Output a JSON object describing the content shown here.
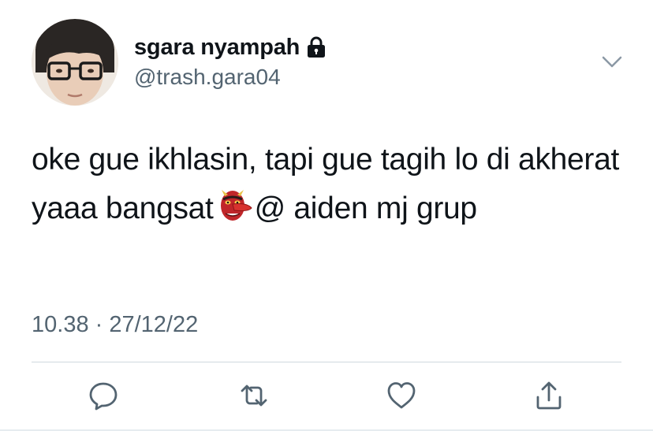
{
  "user": {
    "display_name": "sgara nyampah",
    "handle": "@trash.gara04",
    "protected_icon": "lock-icon",
    "avatar": "profile-photo"
  },
  "tweet": {
    "text_part1": "oke gue ikhlasin, tapi gue tagih lo di akherat yaaa bangsat",
    "emoji": "goblin-mask-emoji",
    "text_part2": "@ aiden mj grup",
    "timestamp": "10.38 · 27/12/22"
  },
  "menu": {
    "icon": "chevron-down-icon"
  },
  "actions": [
    {
      "name": "reply",
      "icon": "speech-bubble-icon"
    },
    {
      "name": "retweet",
      "icon": "retweet-icon"
    },
    {
      "name": "like",
      "icon": "heart-icon"
    },
    {
      "name": "share",
      "icon": "share-icon"
    }
  ],
  "colors": {
    "text_primary": "#0f1419",
    "text_secondary": "#536471",
    "divider": "#cfd9de",
    "icon": "#536471"
  }
}
